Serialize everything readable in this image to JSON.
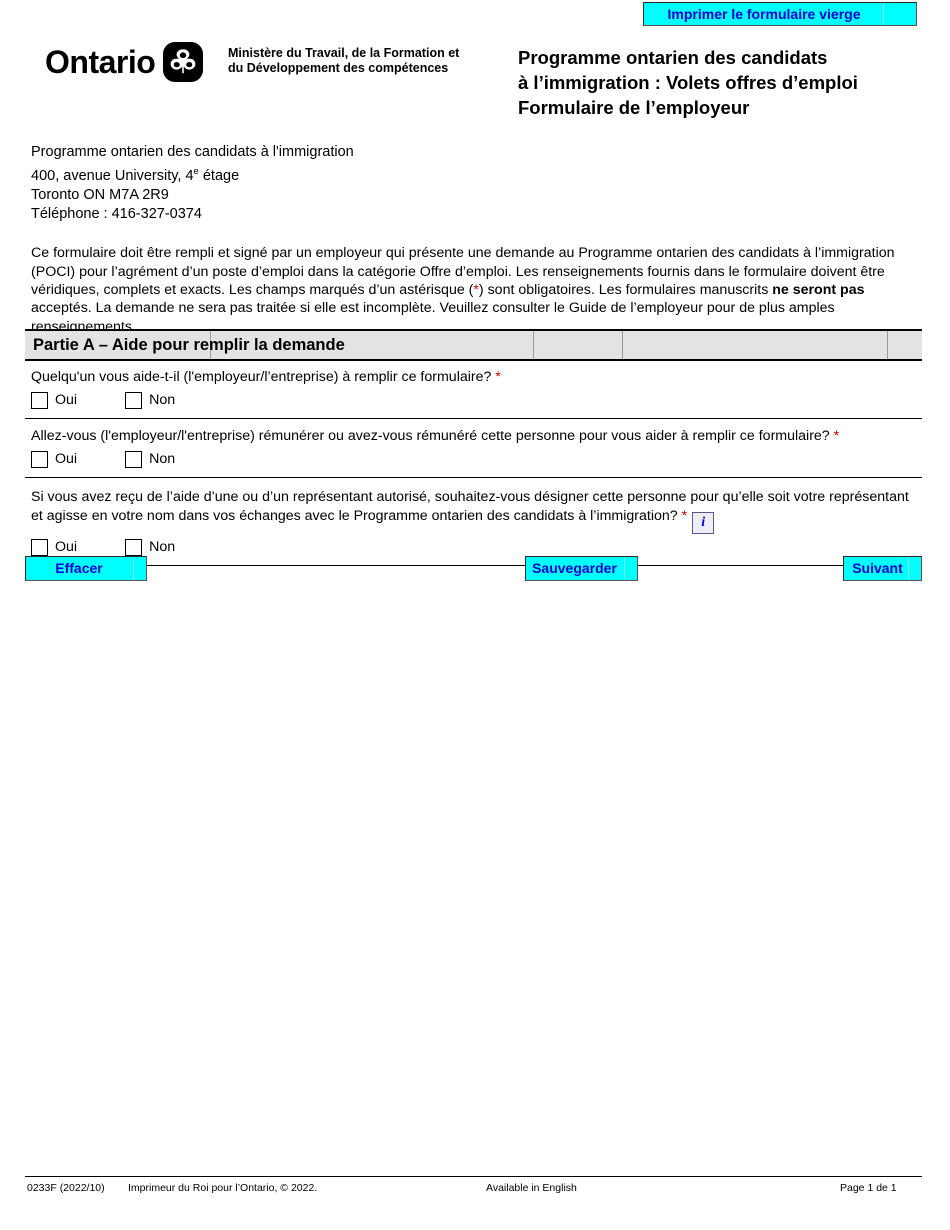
{
  "header": {
    "print_button_label": "Imprimer le formulaire vierge",
    "logo_word": "Ontario",
    "logo_icon": "ontario-trillium-logo",
    "ministry_line1": "Ministère du Travail, de la Formation et",
    "ministry_line2": "du Développement des compétences",
    "form_title_line1": "Programme ontarien des candidats",
    "form_title_line2": "à l’immigration : Volets offres d’emploi",
    "form_title_line3": "Formulaire de l’employeur"
  },
  "address": {
    "line1": "Programme ontarien des candidats à l'immigration",
    "line2_pre": "400, avenue University, 4",
    "line2_sup": "e",
    "line2_post": " étage",
    "line3": "Toronto ON  M7A 2R9",
    "line4": "Téléphone :  416-327-0374"
  },
  "intro": {
    "part1": "Ce formulaire doit être rempli et signé par un employeur qui présente une demande au Programme ontarien des candidats à l’immigration (POCI) pour l’agrément d’un poste d’emploi dans la catégorie Offre d’emploi. Les renseignements fournis dans le formulaire doivent être véridiques, complets et exacts. Les champs marqués d’un astérisque (",
    "asterisk": "*",
    "part2": ") sont obligatoires. Les formulaires manuscrits ",
    "bold": "ne seront pas",
    "part3": " acceptés. La demande ne sera pas traitée si elle est incomplète. Veuillez consulter le Guide de l’employeur pour de plus amples renseignements."
  },
  "section": {
    "title": "Partie A – Aide pour remplir la demande"
  },
  "questions": [
    {
      "text": "Quelqu'un vous aide-t-il (l'employeur/l’entreprise) à remplir ce formulaire?",
      "required_mark": "*",
      "yes_label": "Oui",
      "no_label": "Non",
      "has_info": false
    },
    {
      "text": "Allez-vous (l'employeur/l'entreprise) rémunérer ou avez-vous rémunéré cette personne pour vous aider à remplir ce formulaire?",
      "required_mark": "*",
      "yes_label": "Oui",
      "no_label": "Non",
      "has_info": false
    },
    {
      "text": "Si vous avez reçu de l’aide d’une ou d’un représentant autorisé, souhaitez-vous désigner cette personne pour qu’elle soit votre représentant et agisse en votre nom dans vos échanges avec le Programme ontarien des candidats à l’immigration?",
      "required_mark": "*",
      "yes_label": "Oui",
      "no_label": "Non",
      "has_info": true,
      "info_glyph": "i"
    }
  ],
  "actions": {
    "clear_label": "Effacer",
    "save_label": "Sauvegarder",
    "next_label": "Suivant"
  },
  "footer": {
    "form_code": "0233F (2022/10)",
    "copyright": "Imprimeur du Roi pour l’Ontario, © 2022.",
    "language_link": "Available in English",
    "page_number": "Page 1 de 1"
  },
  "colors": {
    "button_bg": "#00ffff",
    "button_text": "#0000cc",
    "required_asterisk": "#cc0000",
    "section_bar_bg": "#e3e3e3"
  }
}
